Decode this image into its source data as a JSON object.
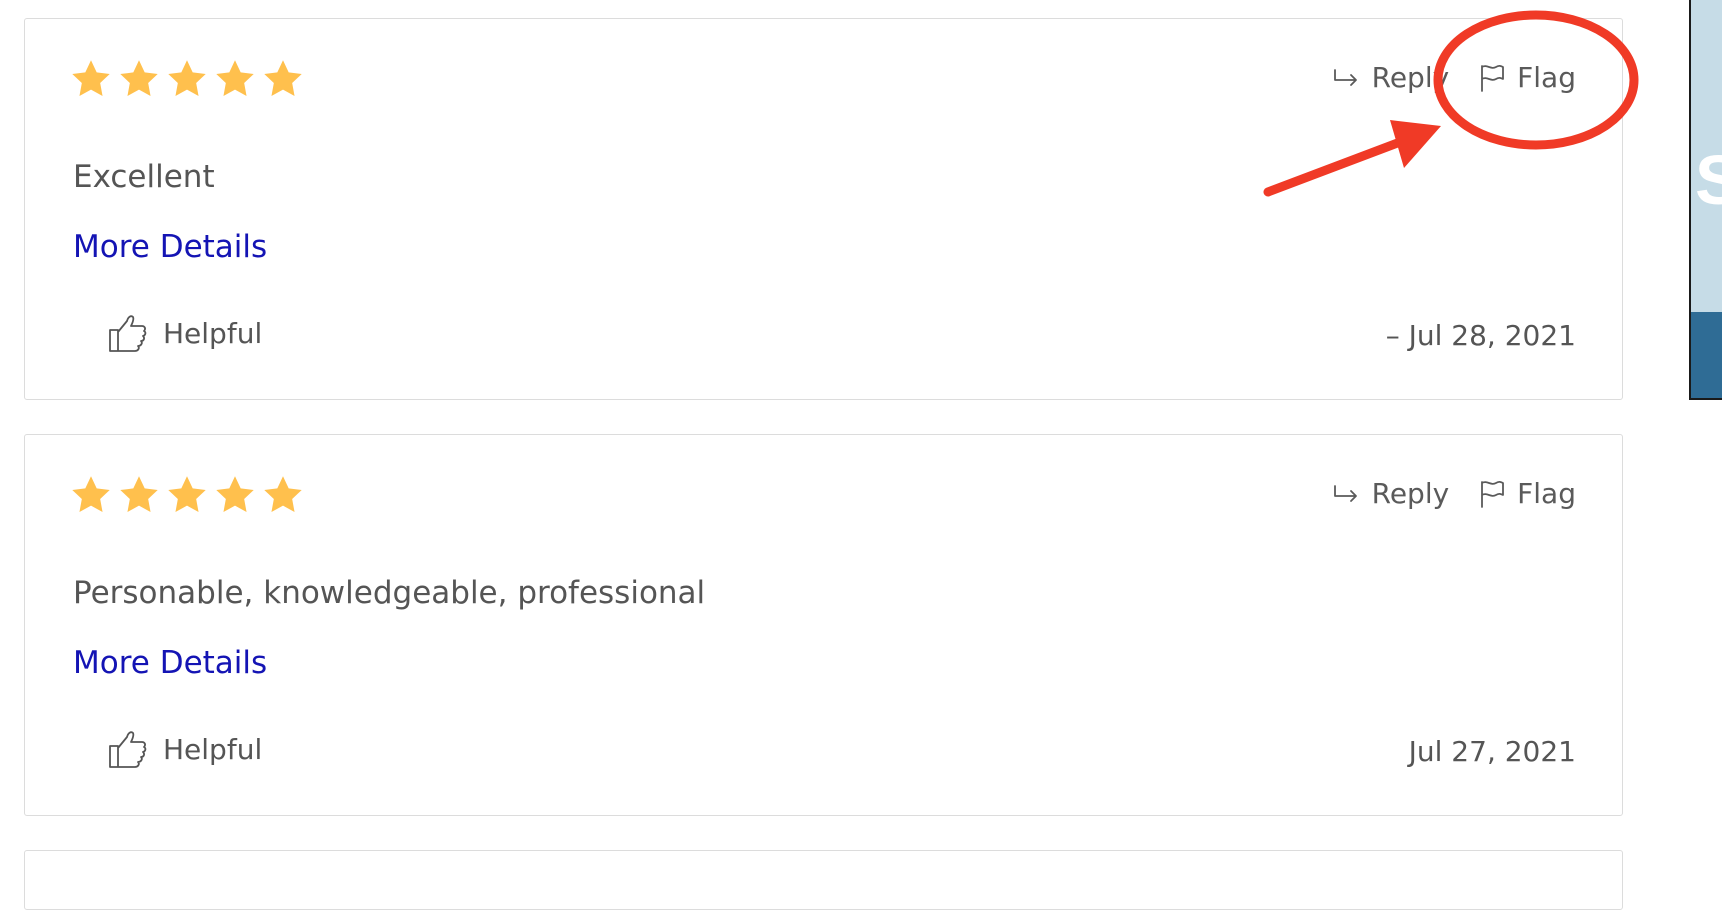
{
  "reviews": [
    {
      "rating": 5,
      "text": "Excellent",
      "more_label": "More Details",
      "helpful_label": "Helpful",
      "date": "– Jul 28, 2021",
      "reply_label": "Reply",
      "flag_label": "Flag"
    },
    {
      "rating": 5,
      "text": "Personable, knowledgeable, professional",
      "more_label": "More Details",
      "helpful_label": "Helpful",
      "date": "Jul 27, 2021",
      "reply_label": "Reply",
      "flag_label": "Flag"
    }
  ],
  "side_panel": {
    "letter": "S"
  },
  "colors": {
    "star": "#ffc04d",
    "link": "#1414b4",
    "annotation": "#f03a26",
    "side_panel_bg": "#c6dce7",
    "side_panel_wave": "#2f6c95"
  },
  "icons": [
    "star-icon",
    "reply-arrow-icon",
    "flag-icon",
    "thumbs-up-icon"
  ]
}
